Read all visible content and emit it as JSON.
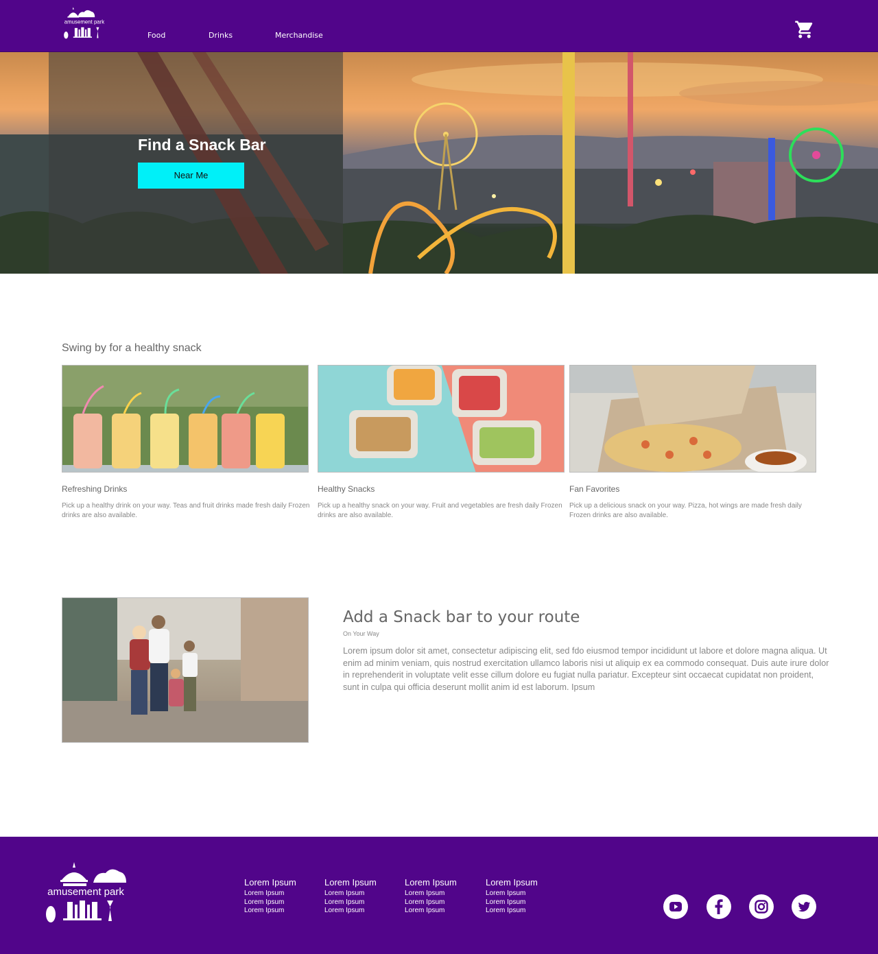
{
  "header": {
    "logo_text": "amusement park",
    "nav": [
      "Food",
      "Drinks",
      "Merchandise"
    ],
    "cart_icon": "shopping-cart-icon"
  },
  "hero": {
    "title": "Find a Snack Bar",
    "button_label": "Near Me"
  },
  "snacks": {
    "heading": "Swing by for a healthy snack",
    "cards": [
      {
        "title": "Refreshing Drinks",
        "description": "Pick up a healthy drink on your way. Teas and fruit drinks made fresh daily Frozen drinks are also available."
      },
      {
        "title": "Healthy Snacks",
        "description": "Pick up a healthy snack on your way. Fruit and vegetables are fresh daily Frozen drinks are also available."
      },
      {
        "title": "Fan Favorites",
        "description": "Pick up a delicious snack on your way. Pizza, hot wings are made fresh daily Frozen drinks are also available."
      }
    ]
  },
  "route": {
    "title": "Add a Snack bar to your route",
    "subtitle": "On Your Way",
    "body": "Lorem ipsum dolor sit amet, consectetur adipiscing elit, sed fdo eiusmod tempor incididunt ut labore et dolore magna aliqua. Ut enim ad minim veniam, quis nostrud exercitation ullamco laboris nisi ut aliquip ex ea commodo consequat. Duis aute irure dolor in reprehenderit in voluptate velit esse cillum dolore eu fugiat nulla pariatur. Excepteur sint occaecat cupidatat non proident, sunt in culpa qui officia deserunt mollit anim id est laborum. Ipsum"
  },
  "footer": {
    "logo_text": "amusement park",
    "columns": [
      {
        "heading": "Lorem Ipsum",
        "items": [
          "Lorem Ipsum",
          "Lorem Ipsum",
          "Lorem Ipsum"
        ]
      },
      {
        "heading": "Lorem Ipsum",
        "items": [
          "Lorem Ipsum",
          "Lorem Ipsum",
          "Lorem Ipsum"
        ]
      },
      {
        "heading": "Lorem Ipsum",
        "items": [
          "Lorem Ipsum",
          "Lorem Ipsum",
          "Lorem Ipsum"
        ]
      },
      {
        "heading": "Lorem Ipsum",
        "items": [
          "Lorem Ipsum",
          "Lorem Ipsum",
          "Lorem Ipsum"
        ]
      }
    ],
    "social_icons": [
      "youtube-icon",
      "facebook-icon",
      "instagram-icon",
      "twitter-icon"
    ]
  },
  "colors": {
    "brand_purple": "#51058a",
    "accent_cyan": "#00f0f8"
  }
}
